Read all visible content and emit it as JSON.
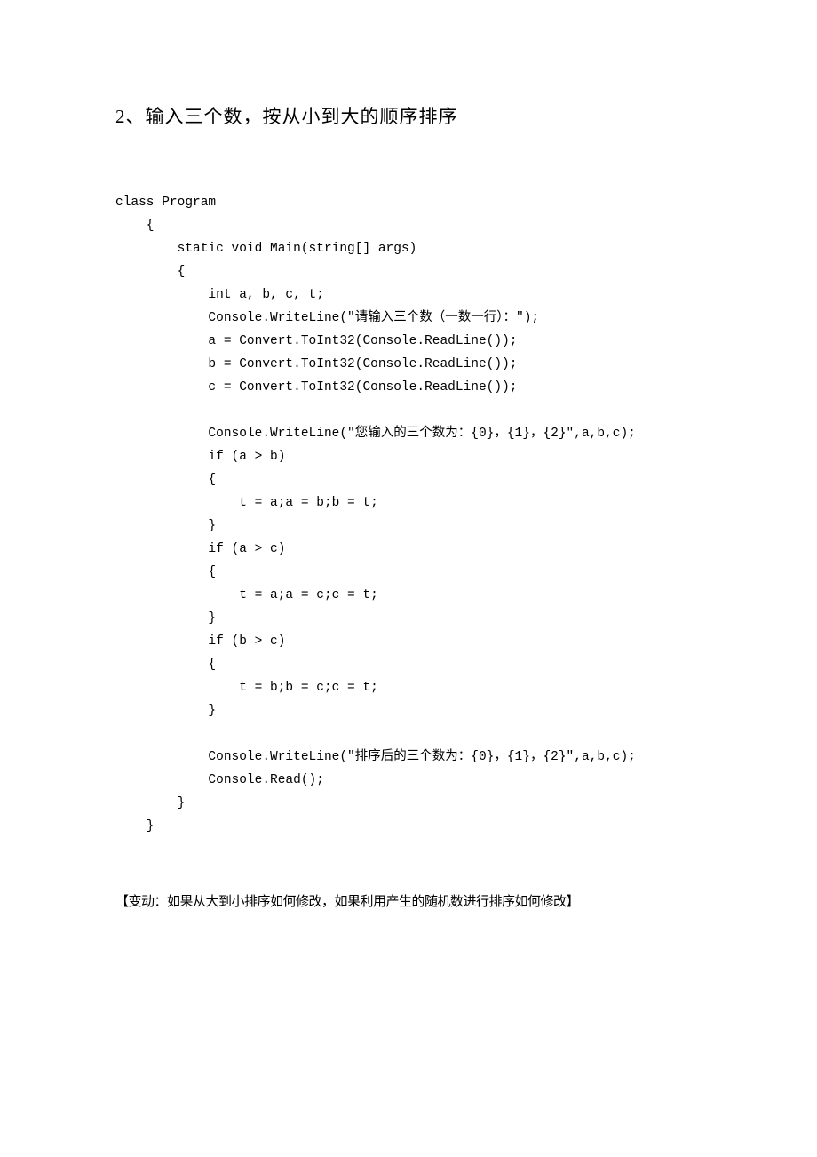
{
  "title": "2、输入三个数，按从小到大的顺序排序",
  "code": {
    "l01": "class Program",
    "l02": "    {",
    "l03": "        static void Main(string[] args)",
    "l04": "        {",
    "l05": "            int a, b, c, t;",
    "l06": "            Console.WriteLine(\"请输入三个数（一数一行）：\");",
    "l07": "            a = Convert.ToInt32(Console.ReadLine());",
    "l08": "            b = Convert.ToInt32(Console.ReadLine());",
    "l09": "            c = Convert.ToInt32(Console.ReadLine());",
    "l10": "",
    "l11": "            Console.WriteLine(\"您输入的三个数为：{0}，{1}，{2}\",a,b,c);",
    "l12": "            if (a > b)",
    "l13": "            {",
    "l14": "                t = a;a = b;b = t;",
    "l15": "            }",
    "l16": "            if (a > c)",
    "l17": "            {",
    "l18": "                t = a;a = c;c = t;",
    "l19": "            }",
    "l20": "            if (b > c)",
    "l21": "            {",
    "l22": "                t = b;b = c;c = t;",
    "l23": "            }",
    "l24": "",
    "l25": "            Console.WriteLine(\"排序后的三个数为：{0}，{1}，{2}\",a,b,c);",
    "l26": "            Console.Read();",
    "l27": "        }",
    "l28": "    }"
  },
  "variation": "【变动：如果从大到小排序如何修改，如果利用产生的随机数进行排序如何修改】"
}
